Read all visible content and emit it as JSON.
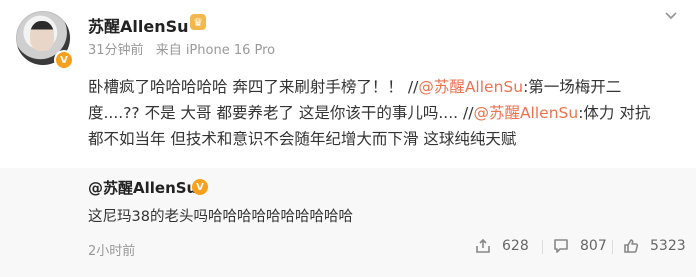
{
  "post": {
    "username": "苏醒AllenSu",
    "meta_time": "31分钟前",
    "meta_source": "来自 iPhone 16 Pro",
    "content": {
      "line1_prefix": "卧槽疯了哈哈哈哈哈 奔四了来刷射手榜了！！  //",
      "mention1": "@苏醒AllenSu",
      "line1_suffix": ":第一场梅开二",
      "line2_prefix": "度....?? 不是 大哥 都要养老了 这是你该干的事儿吗.... //",
      "mention2": "@苏醒AllenSu",
      "line2_suffix": ":体力 对抗",
      "line3": "都不如当年 但技术和意识不会随年纪增大而下滑 这球纯纯天赋"
    }
  },
  "repost": {
    "username": "@苏醒AllenSu",
    "text": "这尼玛38的老头吗哈哈哈哈哈哈哈哈哈哈",
    "time": "2小时前",
    "actions": {
      "share_count": "628",
      "comment_count": "807",
      "like_count": "5323"
    }
  },
  "colors": {
    "mention": "#eb7350",
    "badge": "#f7a01b",
    "text": "#333333",
    "muted": "#999999",
    "repost_bg": "#f8f8f8"
  },
  "icons": {
    "more": "chevron-down-icon",
    "verified": "verified-badge-icon",
    "member": "crown-icon",
    "share": "share-icon",
    "comment": "comment-icon",
    "like": "thumbs-up-icon"
  }
}
